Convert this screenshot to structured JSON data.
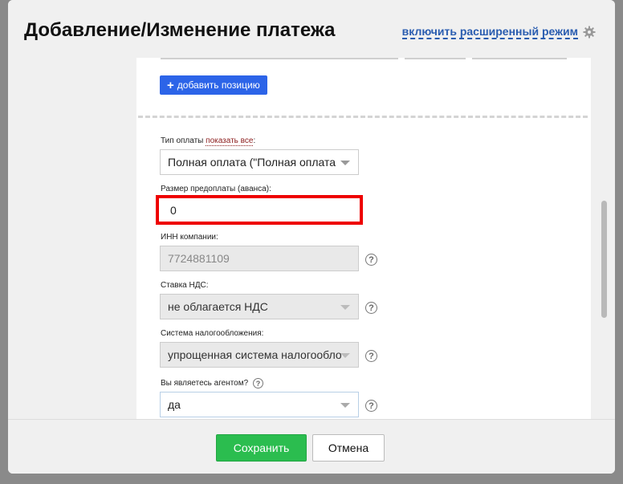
{
  "dialog": {
    "title": "Добавление/Изменение платежа",
    "advanced_mode_link": "включить расширенный режим",
    "advanced_icon": "gear-icon"
  },
  "positions": {
    "add_button_label": "добавить позицию",
    "add_icon": "plus-icon"
  },
  "form": {
    "payment_type": {
      "label": "Тип оплаты",
      "show_all_link": "показать все",
      "label_suffix": ":",
      "value": "Полная оплата (\"Полная оплата"
    },
    "prepayment": {
      "label": "Размер предоплаты (аванса):",
      "value": "0"
    },
    "inn": {
      "label": "ИНН компании:",
      "value": "7724881109"
    },
    "vat": {
      "label": "Ставка НДС:",
      "value": "не облагается НДС"
    },
    "tax_system": {
      "label": "Система налогообложения:",
      "value": "упрощенная система налогообло"
    },
    "agent": {
      "label": "Вы являетесь агентом?",
      "value": "да"
    },
    "help_glyph": "?"
  },
  "footer": {
    "save_label": "Сохранить",
    "cancel_label": "Отмена"
  },
  "colors": {
    "accent": "#2c64e8",
    "save": "#2bbd4f",
    "highlight": "#ee0000",
    "link": "#2a5db0"
  }
}
